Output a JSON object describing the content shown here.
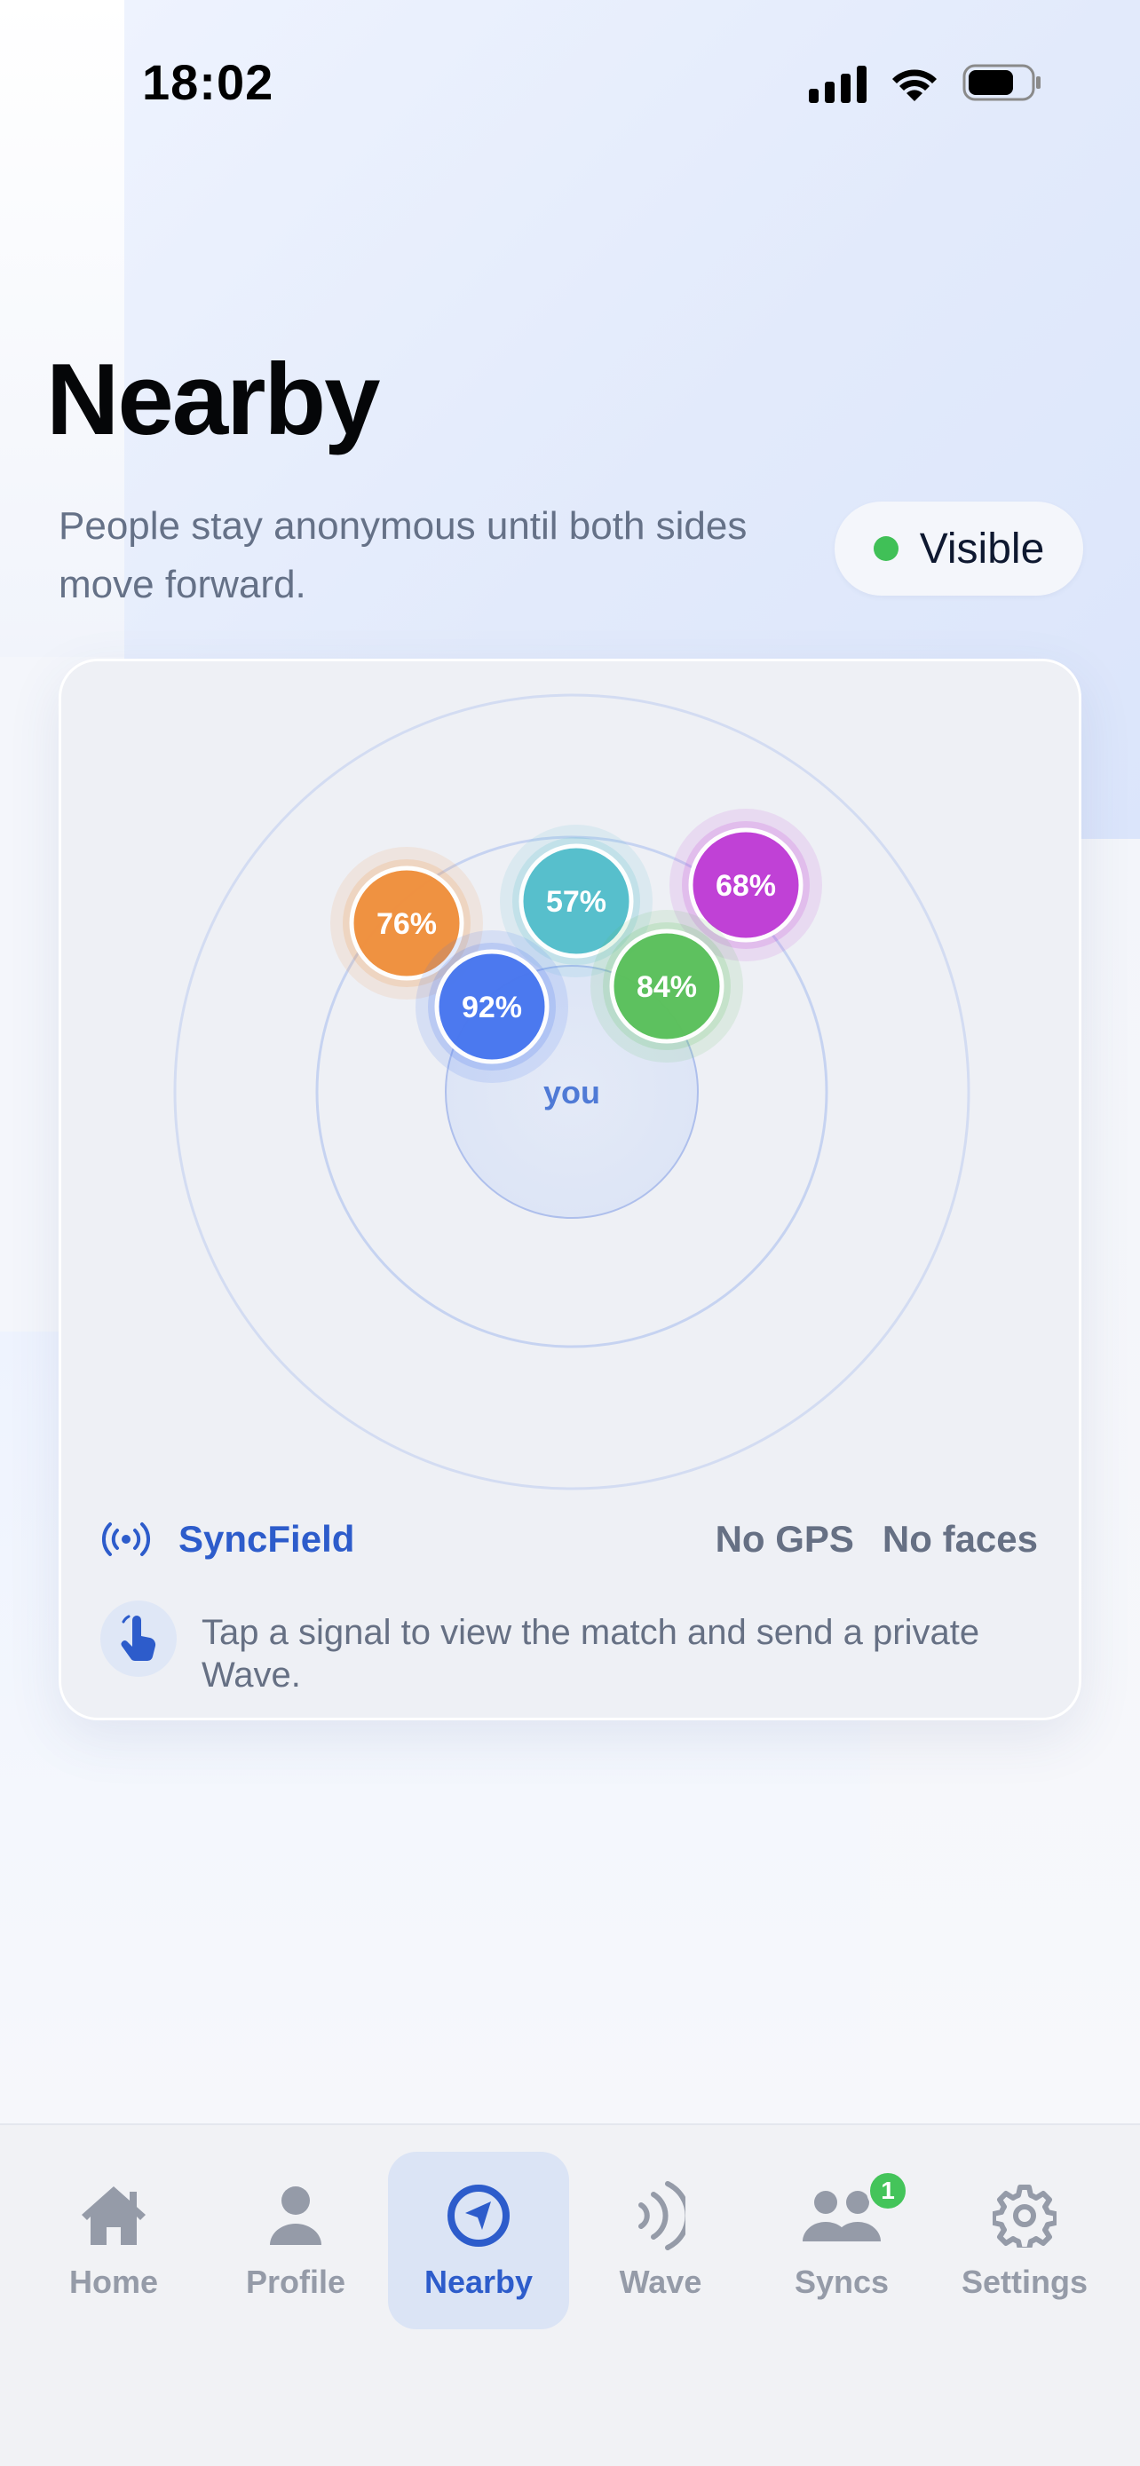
{
  "status_bar": {
    "time": "18:02"
  },
  "header": {
    "title": "Nearby",
    "subtitle": "People stay anonymous until both sides move forward.",
    "visibility": {
      "label": "Visible",
      "status_color": "#40c057"
    }
  },
  "radar": {
    "center_label": "you",
    "signals": [
      {
        "label": "76%",
        "color": "#f0913f",
        "match": 76
      },
      {
        "label": "57%",
        "color": "#55bfcc",
        "match": 57
      },
      {
        "label": "68%",
        "color": "#c03fd6",
        "match": 68
      },
      {
        "label": "92%",
        "color": "#4a78ef",
        "match": 92
      },
      {
        "label": "84%",
        "color": "#5cc15d",
        "match": 84
      }
    ],
    "network_name": "SyncField",
    "privacy_tags": [
      "No GPS",
      "No faces"
    ],
    "hint": "Tap a signal to view the match and send a private Wave."
  },
  "tabs": [
    {
      "label": "Home",
      "icon": "home-icon",
      "active": false
    },
    {
      "label": "Profile",
      "icon": "person-icon",
      "active": false
    },
    {
      "label": "Nearby",
      "icon": "compass-icon",
      "active": true
    },
    {
      "label": "Wave",
      "icon": "wave-icon",
      "active": false
    },
    {
      "label": "Syncs",
      "icon": "people-icon",
      "active": false,
      "badge": "1"
    },
    {
      "label": "Settings",
      "icon": "gear-icon",
      "active": false
    }
  ],
  "colors": {
    "accent": "#2d5ccb",
    "badge": "#44c45a"
  }
}
